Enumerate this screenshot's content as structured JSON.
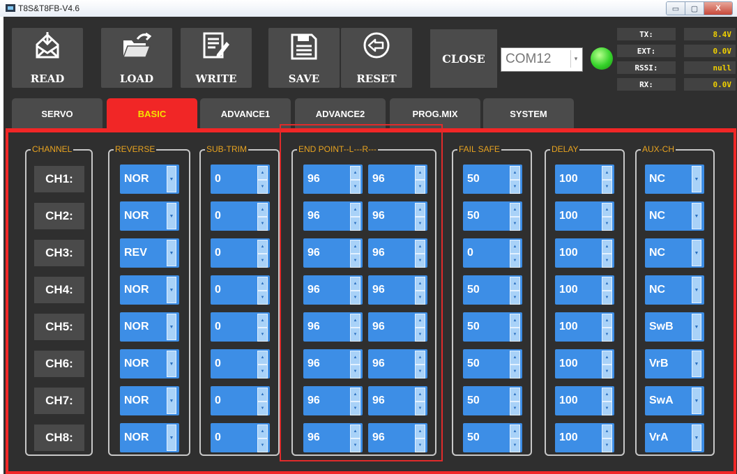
{
  "window": {
    "title": "T8S&T8FB-V4.6",
    "min": "▭",
    "max": "▢",
    "close": "X"
  },
  "toolbar": {
    "read_label": "READ",
    "load_label": "LOAD",
    "write_label": "WRITE",
    "save_label": "SAVE",
    "reset_label": "RESET",
    "close_label": "CLOSE",
    "port_value": "COM12",
    "port_arrow": "▾",
    "link_status_color": "#35d22a"
  },
  "telemetry": [
    {
      "key": "TX:",
      "value": "8.4V"
    },
    {
      "key": "EXT:",
      "value": "0.0V"
    },
    {
      "key": "RSSI:",
      "value": "null"
    },
    {
      "key": "RX:",
      "value": "0.0V"
    }
  ],
  "tabs": [
    "SERVO",
    "BASIC",
    "ADVANCE1",
    "ADVANCE2",
    "PROG.MIX",
    "SYSTEM"
  ],
  "active_tab": "BASIC",
  "colors": {
    "accent": "#f12626",
    "field": "#3d8ee6",
    "group_label": "#e8a320",
    "active_tab_text": "#f5e300"
  },
  "groups": {
    "channel": "CHANNEL",
    "reverse": "REVERSE",
    "subtrim": "SUB-TRIM",
    "endpoint": "END POINT--L---R---",
    "failsafe": "FAIL SAFE",
    "delay": "DELAY",
    "aux": "AUX-CH"
  },
  "channels": [
    {
      "name": "CH1:",
      "reverse": "NOR",
      "subtrim": "0",
      "ep_l": "96",
      "ep_r": "96",
      "failsafe": "50",
      "delay": "100",
      "aux": "NC"
    },
    {
      "name": "CH2:",
      "reverse": "NOR",
      "subtrim": "0",
      "ep_l": "96",
      "ep_r": "96",
      "failsafe": "50",
      "delay": "100",
      "aux": "NC"
    },
    {
      "name": "CH3:",
      "reverse": "REV",
      "subtrim": "0",
      "ep_l": "96",
      "ep_r": "96",
      "failsafe": "0",
      "delay": "100",
      "aux": "NC"
    },
    {
      "name": "CH4:",
      "reverse": "NOR",
      "subtrim": "0",
      "ep_l": "96",
      "ep_r": "96",
      "failsafe": "50",
      "delay": "100",
      "aux": "NC"
    },
    {
      "name": "CH5:",
      "reverse": "NOR",
      "subtrim": "0",
      "ep_l": "96",
      "ep_r": "96",
      "failsafe": "50",
      "delay": "100",
      "aux": "SwB"
    },
    {
      "name": "CH6:",
      "reverse": "NOR",
      "subtrim": "0",
      "ep_l": "96",
      "ep_r": "96",
      "failsafe": "50",
      "delay": "100",
      "aux": "VrB"
    },
    {
      "name": "CH7:",
      "reverse": "NOR",
      "subtrim": "0",
      "ep_l": "96",
      "ep_r": "96",
      "failsafe": "50",
      "delay": "100",
      "aux": "SwA"
    },
    {
      "name": "CH8:",
      "reverse": "NOR",
      "subtrim": "0",
      "ep_l": "96",
      "ep_r": "96",
      "failsafe": "50",
      "delay": "100",
      "aux": "VrA"
    }
  ]
}
